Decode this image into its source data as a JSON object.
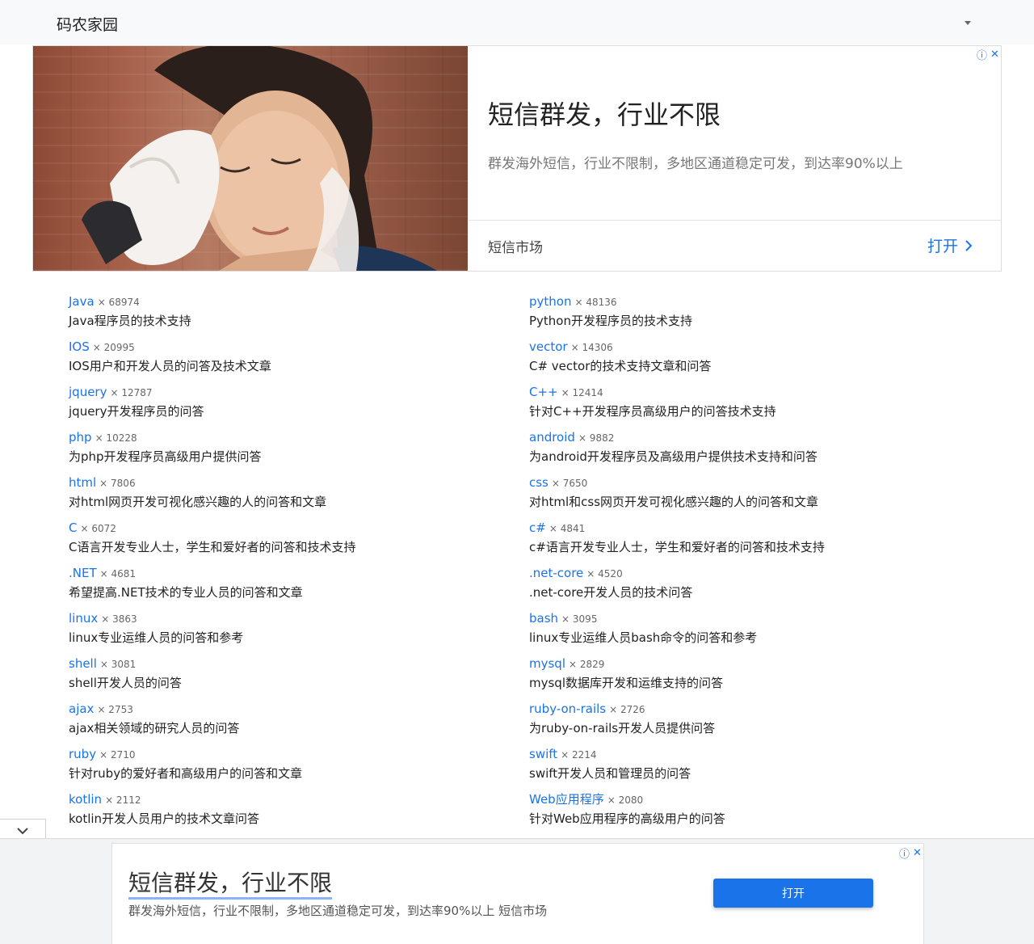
{
  "navbar": {
    "brand": "码农家园"
  },
  "ad_top": {
    "headline": "短信群发，行业不限",
    "description": "群发海外短信，行业不限制，多地区通道稳定可发，到达率90%以上",
    "advertiser": "短信市场",
    "open_label": "打开"
  },
  "tags": [
    {
      "name": "Java",
      "count": "× 68974",
      "desc": "Java程序员的技术支持"
    },
    {
      "name": "python",
      "count": "× 48136",
      "desc": "Python开发程序员的技术支持"
    },
    {
      "name": "IOS",
      "count": "× 20995",
      "desc": "IOS用户和开发人员的问答及技术文章"
    },
    {
      "name": "vector",
      "count": "× 14306",
      "desc": "C# vector的技术支持文章和问答"
    },
    {
      "name": "jquery",
      "count": "× 12787",
      "desc": "jquery开发程序员的问答"
    },
    {
      "name": "C++",
      "count": "× 12414",
      "desc": "针对C++开发程序员高级用户的问答技术支持"
    },
    {
      "name": "php",
      "count": "× 10228",
      "desc": "为php开发程序员高级用户提供问答"
    },
    {
      "name": "android",
      "count": "× 9882",
      "desc": "为android开发程序员及高级用户提供技术支持和问答"
    },
    {
      "name": "html",
      "count": "× 7806",
      "desc": "对html网页开发可视化感兴趣的人的问答和文章"
    },
    {
      "name": "css",
      "count": "× 7650",
      "desc": "对html和css网页开发可视化感兴趣的人的问答和文章"
    },
    {
      "name": "C",
      "count": "× 6072",
      "desc": "C语言开发专业人士，学生和爱好者的问答和技术支持"
    },
    {
      "name": "c#",
      "count": "× 4841",
      "desc": "c#语言开发专业人士，学生和爱好者的问答和技术支持"
    },
    {
      "name": ".NET",
      "count": "× 4681",
      "desc": "希望提高.NET技术的专业人员的问答和文章"
    },
    {
      "name": ".net-core",
      "count": "× 4520",
      "desc": ".net-core开发人员的技术问答"
    },
    {
      "name": "linux",
      "count": "× 3863",
      "desc": "linux专业运维人员的问答和参考"
    },
    {
      "name": "bash",
      "count": "× 3095",
      "desc": "linux专业运维人员bash命令的问答和参考"
    },
    {
      "name": "shell",
      "count": "× 3081",
      "desc": "shell开发人员的问答"
    },
    {
      "name": "mysql",
      "count": "× 2829",
      "desc": "mysql数据库开发和运维支持的问答"
    },
    {
      "name": "ajax",
      "count": "× 2753",
      "desc": "ajax相关领域的研究人员的问答"
    },
    {
      "name": "ruby-on-rails",
      "count": "× 2726",
      "desc": "为ruby-on-rails开发人员提供问答"
    },
    {
      "name": "ruby",
      "count": "× 2710",
      "desc": "针对ruby的爱好者和高级用户的问答和文章"
    },
    {
      "name": "swift",
      "count": "× 2214",
      "desc": "swift开发人员和管理员的问答"
    },
    {
      "name": "kotlin",
      "count": "× 2112",
      "desc": "kotlin开发人员用户的技术文章问答"
    },
    {
      "name": "Web应用程序",
      "count": "× 2080",
      "desc": "针对Web应用程序的高级用户的问答"
    }
  ],
  "ad_bottom": {
    "headline": "短信群发，行业不限",
    "description": "群发海外短信，行业不限制，多地区通道稳定可发，到达率90%以上 短信市场",
    "open_label": "打开"
  },
  "colors": {
    "link": "#1a73e8",
    "navbar_bg": "#f8f9fa",
    "button": "#1a73e8"
  }
}
